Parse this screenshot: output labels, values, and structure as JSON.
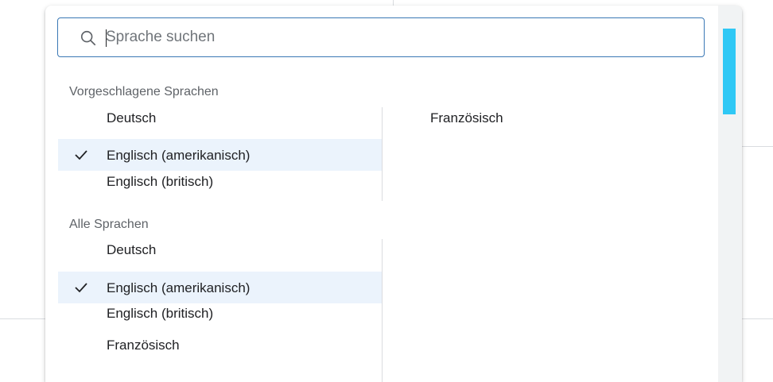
{
  "search": {
    "placeholder": "Sprache suchen",
    "value": ""
  },
  "suggested": {
    "title": "Vorgeschlagene Sprachen",
    "items": [
      {
        "label": "Deutsch",
        "selected": false
      },
      {
        "label": "Englisch (amerikanisch)",
        "selected": true
      },
      {
        "label": "Englisch (britisch)",
        "selected": false
      },
      {
        "label": "Französisch",
        "selected": false
      }
    ]
  },
  "all": {
    "title": "Alle Sprachen",
    "items": [
      {
        "label": "Deutsch",
        "selected": false
      },
      {
        "label": "Englisch (amerikanisch)",
        "selected": true
      },
      {
        "label": "Englisch (britisch)",
        "selected": false
      },
      {
        "label": "Französisch",
        "selected": false
      }
    ]
  },
  "colors": {
    "accent": "#1a73e8",
    "selected_bg": "#ebf3fc",
    "scroll_thumb": "#2fc8f5"
  },
  "icons": {
    "search": "search-icon",
    "check": "check-icon"
  }
}
